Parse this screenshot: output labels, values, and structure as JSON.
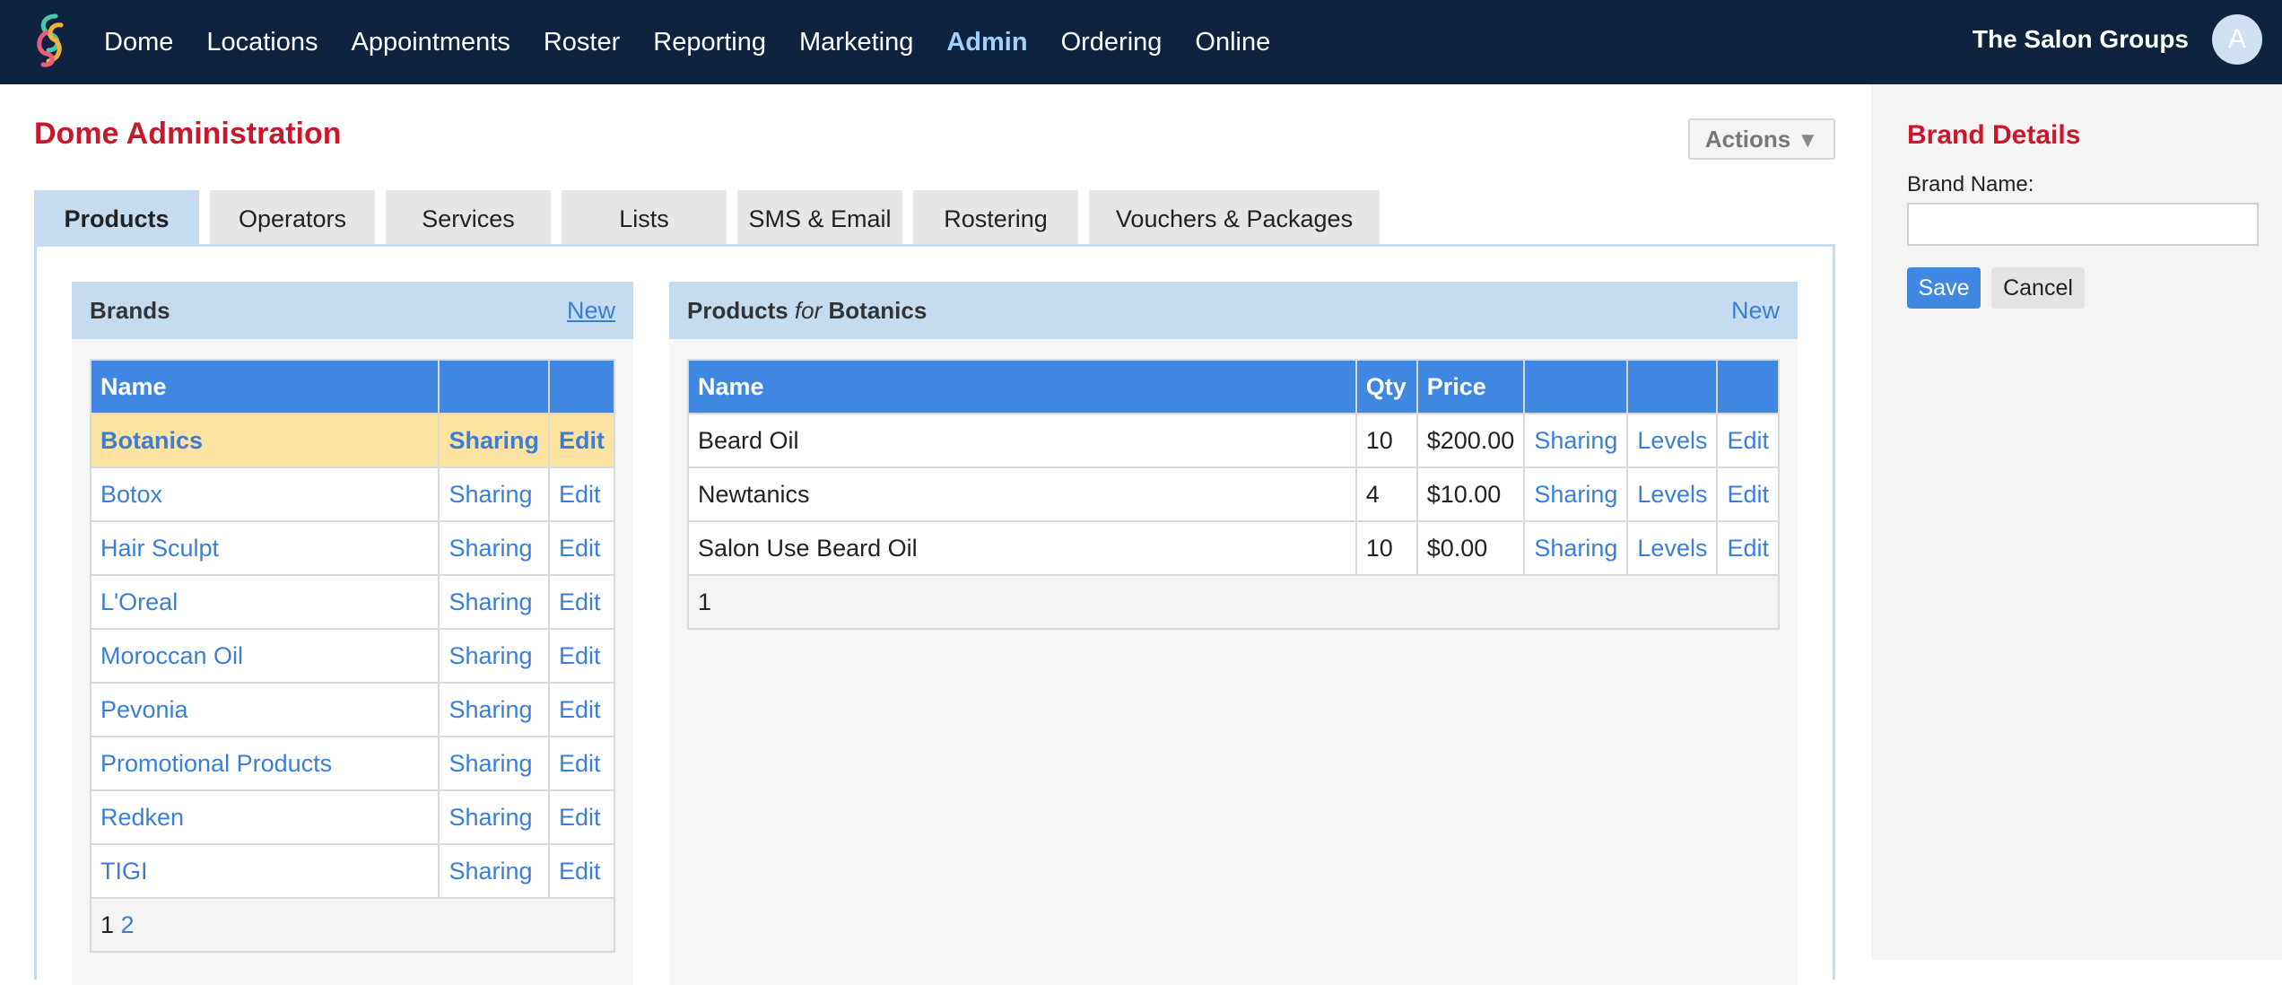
{
  "nav": {
    "items": [
      {
        "label": "Dome",
        "active": false
      },
      {
        "label": "Locations",
        "active": false
      },
      {
        "label": "Appointments",
        "active": false
      },
      {
        "label": "Roster",
        "active": false
      },
      {
        "label": "Reporting",
        "active": false
      },
      {
        "label": "Marketing",
        "active": false
      },
      {
        "label": "Admin",
        "active": true
      },
      {
        "label": "Ordering",
        "active": false
      },
      {
        "label": "Online",
        "active": false
      }
    ],
    "org_name": "The Salon Groups",
    "avatar_initial": "A"
  },
  "page": {
    "title": "Dome Administration",
    "actions_label": "Actions",
    "actions_icon": "triangle-down-icon"
  },
  "tabs": [
    {
      "label": "Products",
      "active": true
    },
    {
      "label": "Operators",
      "active": false
    },
    {
      "label": "Services",
      "active": false
    },
    {
      "label": "Lists",
      "active": false
    },
    {
      "label": "SMS & Email",
      "active": false
    },
    {
      "label": "Rostering",
      "active": false
    },
    {
      "label": "Vouchers & Packages",
      "active": false
    }
  ],
  "brands": {
    "title": "Brands",
    "new_label": "New",
    "columns": [
      "Name",
      "",
      ""
    ],
    "rows": [
      {
        "name": "Botanics",
        "sharing": "Sharing",
        "edit": "Edit",
        "selected": true
      },
      {
        "name": "Botox",
        "sharing": "Sharing",
        "edit": "Edit",
        "selected": false
      },
      {
        "name": "Hair Sculpt",
        "sharing": "Sharing",
        "edit": "Edit",
        "selected": false
      },
      {
        "name": "L'Oreal",
        "sharing": "Sharing",
        "edit": "Edit",
        "selected": false
      },
      {
        "name": "Moroccan Oil",
        "sharing": "Sharing",
        "edit": "Edit",
        "selected": false
      },
      {
        "name": "Pevonia",
        "sharing": "Sharing",
        "edit": "Edit",
        "selected": false
      },
      {
        "name": "Promotional Products",
        "sharing": "Sharing",
        "edit": "Edit",
        "selected": false
      },
      {
        "name": "Redken",
        "sharing": "Sharing",
        "edit": "Edit",
        "selected": false
      },
      {
        "name": "TIGI",
        "sharing": "Sharing",
        "edit": "Edit",
        "selected": false
      }
    ],
    "pager": {
      "current": "1",
      "other": "2"
    }
  },
  "products": {
    "title_prefix": "Products",
    "title_for": "for",
    "title_brand": "Botanics",
    "new_label": "New",
    "columns": [
      "Name",
      "Qty",
      "Price",
      "",
      "",
      ""
    ],
    "rows": [
      {
        "name": "Beard Oil",
        "qty": "10",
        "price": "$200.00",
        "sharing": "Sharing",
        "levels": "Levels",
        "edit": "Edit"
      },
      {
        "name": "Newtanics",
        "qty": "4",
        "price": "$10.00",
        "sharing": "Sharing",
        "levels": "Levels",
        "edit": "Edit"
      },
      {
        "name": "Salon Use Beard Oil",
        "qty": "10",
        "price": "$0.00",
        "sharing": "Sharing",
        "levels": "Levels",
        "edit": "Edit"
      }
    ],
    "pager": {
      "current": "1"
    }
  },
  "brand_details": {
    "title": "Brand Details",
    "name_label": "Brand Name:",
    "name_value": "",
    "save_label": "Save",
    "cancel_label": "Cancel"
  },
  "colors": {
    "topbar": "#0e2340",
    "accent_red": "#c8192c",
    "link_blue": "#3a7fd5",
    "header_blue": "#3f87e0",
    "selected_row": "#fde3a2"
  }
}
